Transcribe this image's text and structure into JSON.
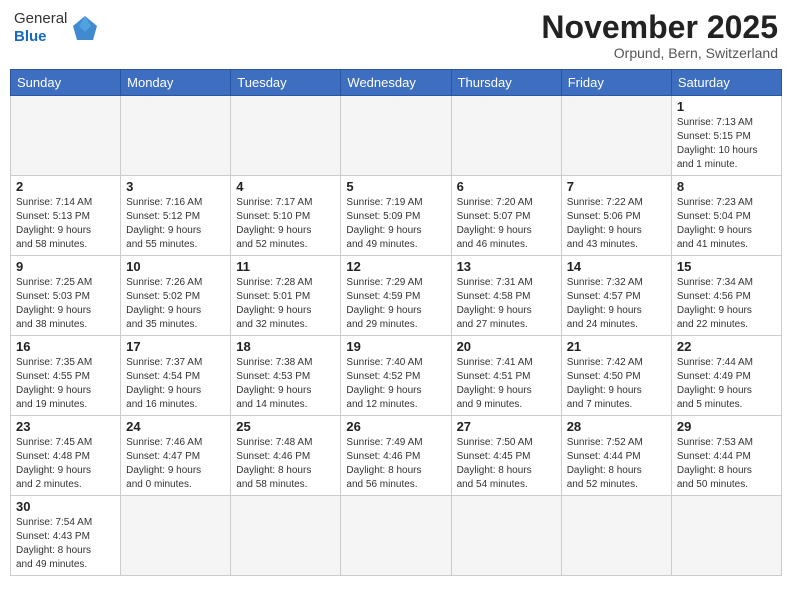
{
  "logo": {
    "general": "General",
    "blue": "Blue"
  },
  "header": {
    "month": "November 2025",
    "location": "Orpund, Bern, Switzerland"
  },
  "weekdays": [
    "Sunday",
    "Monday",
    "Tuesday",
    "Wednesday",
    "Thursday",
    "Friday",
    "Saturday"
  ],
  "weeks": [
    [
      {
        "day": "",
        "info": ""
      },
      {
        "day": "",
        "info": ""
      },
      {
        "day": "",
        "info": ""
      },
      {
        "day": "",
        "info": ""
      },
      {
        "day": "",
        "info": ""
      },
      {
        "day": "",
        "info": ""
      },
      {
        "day": "1",
        "info": "Sunrise: 7:13 AM\nSunset: 5:15 PM\nDaylight: 10 hours\nand 1 minute."
      }
    ],
    [
      {
        "day": "2",
        "info": "Sunrise: 7:14 AM\nSunset: 5:13 PM\nDaylight: 9 hours\nand 58 minutes."
      },
      {
        "day": "3",
        "info": "Sunrise: 7:16 AM\nSunset: 5:12 PM\nDaylight: 9 hours\nand 55 minutes."
      },
      {
        "day": "4",
        "info": "Sunrise: 7:17 AM\nSunset: 5:10 PM\nDaylight: 9 hours\nand 52 minutes."
      },
      {
        "day": "5",
        "info": "Sunrise: 7:19 AM\nSunset: 5:09 PM\nDaylight: 9 hours\nand 49 minutes."
      },
      {
        "day": "6",
        "info": "Sunrise: 7:20 AM\nSunset: 5:07 PM\nDaylight: 9 hours\nand 46 minutes."
      },
      {
        "day": "7",
        "info": "Sunrise: 7:22 AM\nSunset: 5:06 PM\nDaylight: 9 hours\nand 43 minutes."
      },
      {
        "day": "8",
        "info": "Sunrise: 7:23 AM\nSunset: 5:04 PM\nDaylight: 9 hours\nand 41 minutes."
      }
    ],
    [
      {
        "day": "9",
        "info": "Sunrise: 7:25 AM\nSunset: 5:03 PM\nDaylight: 9 hours\nand 38 minutes."
      },
      {
        "day": "10",
        "info": "Sunrise: 7:26 AM\nSunset: 5:02 PM\nDaylight: 9 hours\nand 35 minutes."
      },
      {
        "day": "11",
        "info": "Sunrise: 7:28 AM\nSunset: 5:01 PM\nDaylight: 9 hours\nand 32 minutes."
      },
      {
        "day": "12",
        "info": "Sunrise: 7:29 AM\nSunset: 4:59 PM\nDaylight: 9 hours\nand 29 minutes."
      },
      {
        "day": "13",
        "info": "Sunrise: 7:31 AM\nSunset: 4:58 PM\nDaylight: 9 hours\nand 27 minutes."
      },
      {
        "day": "14",
        "info": "Sunrise: 7:32 AM\nSunset: 4:57 PM\nDaylight: 9 hours\nand 24 minutes."
      },
      {
        "day": "15",
        "info": "Sunrise: 7:34 AM\nSunset: 4:56 PM\nDaylight: 9 hours\nand 22 minutes."
      }
    ],
    [
      {
        "day": "16",
        "info": "Sunrise: 7:35 AM\nSunset: 4:55 PM\nDaylight: 9 hours\nand 19 minutes."
      },
      {
        "day": "17",
        "info": "Sunrise: 7:37 AM\nSunset: 4:54 PM\nDaylight: 9 hours\nand 16 minutes."
      },
      {
        "day": "18",
        "info": "Sunrise: 7:38 AM\nSunset: 4:53 PM\nDaylight: 9 hours\nand 14 minutes."
      },
      {
        "day": "19",
        "info": "Sunrise: 7:40 AM\nSunset: 4:52 PM\nDaylight: 9 hours\nand 12 minutes."
      },
      {
        "day": "20",
        "info": "Sunrise: 7:41 AM\nSunset: 4:51 PM\nDaylight: 9 hours\nand 9 minutes."
      },
      {
        "day": "21",
        "info": "Sunrise: 7:42 AM\nSunset: 4:50 PM\nDaylight: 9 hours\nand 7 minutes."
      },
      {
        "day": "22",
        "info": "Sunrise: 7:44 AM\nSunset: 4:49 PM\nDaylight: 9 hours\nand 5 minutes."
      }
    ],
    [
      {
        "day": "23",
        "info": "Sunrise: 7:45 AM\nSunset: 4:48 PM\nDaylight: 9 hours\nand 2 minutes."
      },
      {
        "day": "24",
        "info": "Sunrise: 7:46 AM\nSunset: 4:47 PM\nDaylight: 9 hours\nand 0 minutes."
      },
      {
        "day": "25",
        "info": "Sunrise: 7:48 AM\nSunset: 4:46 PM\nDaylight: 8 hours\nand 58 minutes."
      },
      {
        "day": "26",
        "info": "Sunrise: 7:49 AM\nSunset: 4:46 PM\nDaylight: 8 hours\nand 56 minutes."
      },
      {
        "day": "27",
        "info": "Sunrise: 7:50 AM\nSunset: 4:45 PM\nDaylight: 8 hours\nand 54 minutes."
      },
      {
        "day": "28",
        "info": "Sunrise: 7:52 AM\nSunset: 4:44 PM\nDaylight: 8 hours\nand 52 minutes."
      },
      {
        "day": "29",
        "info": "Sunrise: 7:53 AM\nSunset: 4:44 PM\nDaylight: 8 hours\nand 50 minutes."
      }
    ],
    [
      {
        "day": "30",
        "info": "Sunrise: 7:54 AM\nSunset: 4:43 PM\nDaylight: 8 hours\nand 49 minutes."
      },
      {
        "day": "",
        "info": ""
      },
      {
        "day": "",
        "info": ""
      },
      {
        "day": "",
        "info": ""
      },
      {
        "day": "",
        "info": ""
      },
      {
        "day": "",
        "info": ""
      },
      {
        "day": "",
        "info": ""
      }
    ]
  ]
}
